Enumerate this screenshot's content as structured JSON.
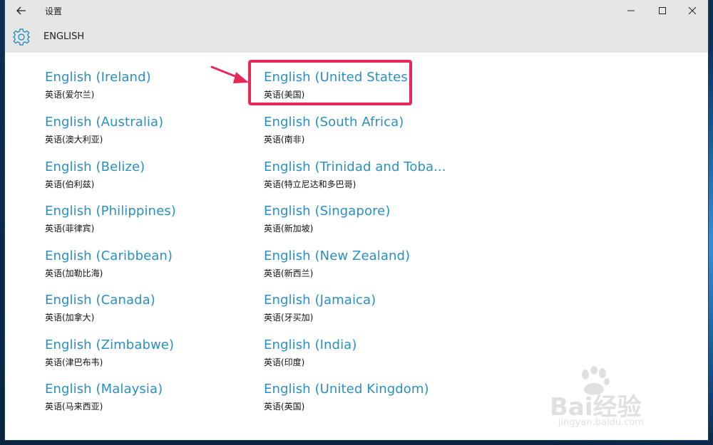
{
  "window": {
    "title": "设置",
    "section_title": "ENGLISH"
  },
  "icons": {
    "back": "back-arrow-icon",
    "gear": "gear-icon",
    "minimize": "minimize-icon",
    "maximize": "maximize-icon",
    "close": "close-icon"
  },
  "colors": {
    "link": "#2a8fc4",
    "highlight": "#e8275b",
    "titlebar": "#e6e6e6"
  },
  "languages_col1": [
    {
      "name": "English (Ireland)",
      "native": "英语(爱尔兰)"
    },
    {
      "name": "English (Australia)",
      "native": "英语(澳大利亚)"
    },
    {
      "name": "English (Belize)",
      "native": "英语(伯利兹)"
    },
    {
      "name": "English (Philippines)",
      "native": "英语(菲律宾)"
    },
    {
      "name": "English (Caribbean)",
      "native": "英语(加勒比海)"
    },
    {
      "name": "English (Canada)",
      "native": "英语(加拿大)"
    },
    {
      "name": "English (Zimbabwe)",
      "native": "英语(津巴布韦)"
    },
    {
      "name": "English (Malaysia)",
      "native": "英语(马来西亚)"
    }
  ],
  "languages_col2": [
    {
      "name": "English (United States)",
      "native": "英语(美国)"
    },
    {
      "name": "English (South Africa)",
      "native": "英语(南非)"
    },
    {
      "name": "English (Trinidad and Toba...",
      "native": "英语(特立尼达和多巴哥)"
    },
    {
      "name": "English (Singapore)",
      "native": "英语(新加坡)"
    },
    {
      "name": "English (New Zealand)",
      "native": "英语(新西兰)"
    },
    {
      "name": "English (Jamaica)",
      "native": "英语(牙买加)"
    },
    {
      "name": "English (India)",
      "native": "英语(印度)"
    },
    {
      "name": "English (United Kingdom)",
      "native": "英语(英国)"
    }
  ],
  "watermark": {
    "brand": "Bai经验",
    "url": "jingyan.baidu.com"
  }
}
